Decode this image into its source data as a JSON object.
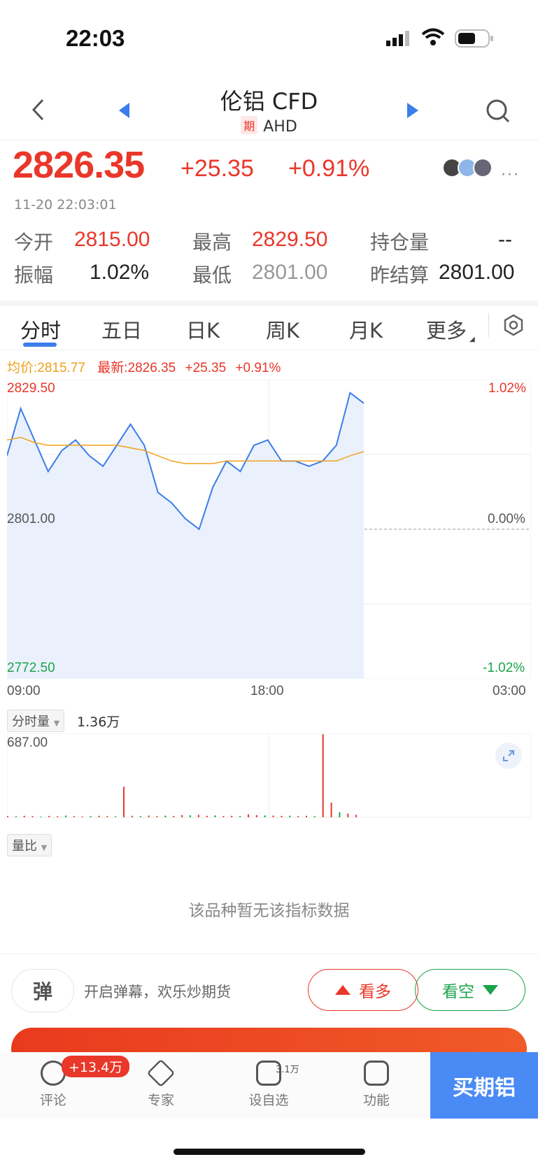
{
  "status": {
    "time": "22:03"
  },
  "nav": {
    "title": "伦铝 CFD",
    "badge": "期",
    "code": "AHD"
  },
  "quote": {
    "price": "2826.35",
    "change": "+25.35",
    "change_pct": "+0.91%",
    "timestamp": "11-20 22:03:01",
    "open_label": "今开",
    "open": "2815.00",
    "high_label": "最高",
    "high": "2829.50",
    "oi_label": "持仓量",
    "oi": "--",
    "amp_label": "振幅",
    "amp": "1.02%",
    "low_label": "最低",
    "low": "2801.00",
    "prev_label": "昨结算",
    "prev": "2801.00"
  },
  "tabs": [
    "分时",
    "五日",
    "日K",
    "周K",
    "月K",
    "更多"
  ],
  "legend": {
    "avg": "均价:2815.77",
    "latest": "最新:2826.35",
    "chg": "+25.35",
    "pct": "+0.91%"
  },
  "chart_data": {
    "type": "line",
    "title": "",
    "y_max": "2829.50",
    "y_mid": "2801.00",
    "y_min": "2772.50",
    "pct_max": "1.02%",
    "pct_mid": "0.00%",
    "pct_min": "-1.02%",
    "x_ticks": [
      "09:00",
      "18:00",
      "03:00"
    ],
    "ylim": [
      2772.5,
      2829.5
    ],
    "price": [
      2815,
      2824,
      2818,
      2812,
      2816,
      2818,
      2815,
      2813,
      2817,
      2821,
      2817,
      2808,
      2806,
      2803,
      2801,
      2809,
      2814,
      2812,
      2817,
      2818,
      2814,
      2814,
      2813,
      2814,
      2817,
      2827,
      2825
    ],
    "avg": [
      2818,
      2818.5,
      2817.5,
      2817,
      2817,
      2817,
      2817,
      2817,
      2817,
      2816.5,
      2816,
      2815,
      2814,
      2813.5,
      2813.5,
      2813.5,
      2814,
      2814,
      2814,
      2814,
      2814,
      2814,
      2814,
      2814,
      2814,
      2815,
      2815.8
    ]
  },
  "volume": {
    "indicator": "分时量",
    "total": "1.36万",
    "max": "687.00",
    "bars": [
      10,
      8,
      12,
      9,
      6,
      11,
      8,
      14,
      9,
      7,
      10,
      12,
      9,
      8,
      250,
      12,
      9,
      14,
      10,
      13,
      11,
      18,
      16,
      20,
      12,
      15,
      10,
      12,
      9,
      24,
      18,
      15,
      14,
      11,
      13,
      10,
      12,
      9,
      680,
      120,
      40,
      30,
      20
    ]
  },
  "ratio": {
    "indicator": "量比",
    "empty": "该品种暂无该指标数据"
  },
  "barrage": {
    "label": "弹",
    "prompt": "开启弹幕，欢乐炒期货"
  },
  "bull": "看多",
  "bear": "看空",
  "tabbar": {
    "comment": "评论",
    "comment_badge": "+13.4万",
    "expert": "专家",
    "watch": "设自选",
    "watch_badge": "3.1万",
    "func": "功能",
    "buy": "买期铝"
  },
  "colors": {
    "up": "#e9372a",
    "down": "#1aa34a",
    "line": "#3b7dea",
    "avg": "#f0a020",
    "accent": "#4a8af4"
  }
}
